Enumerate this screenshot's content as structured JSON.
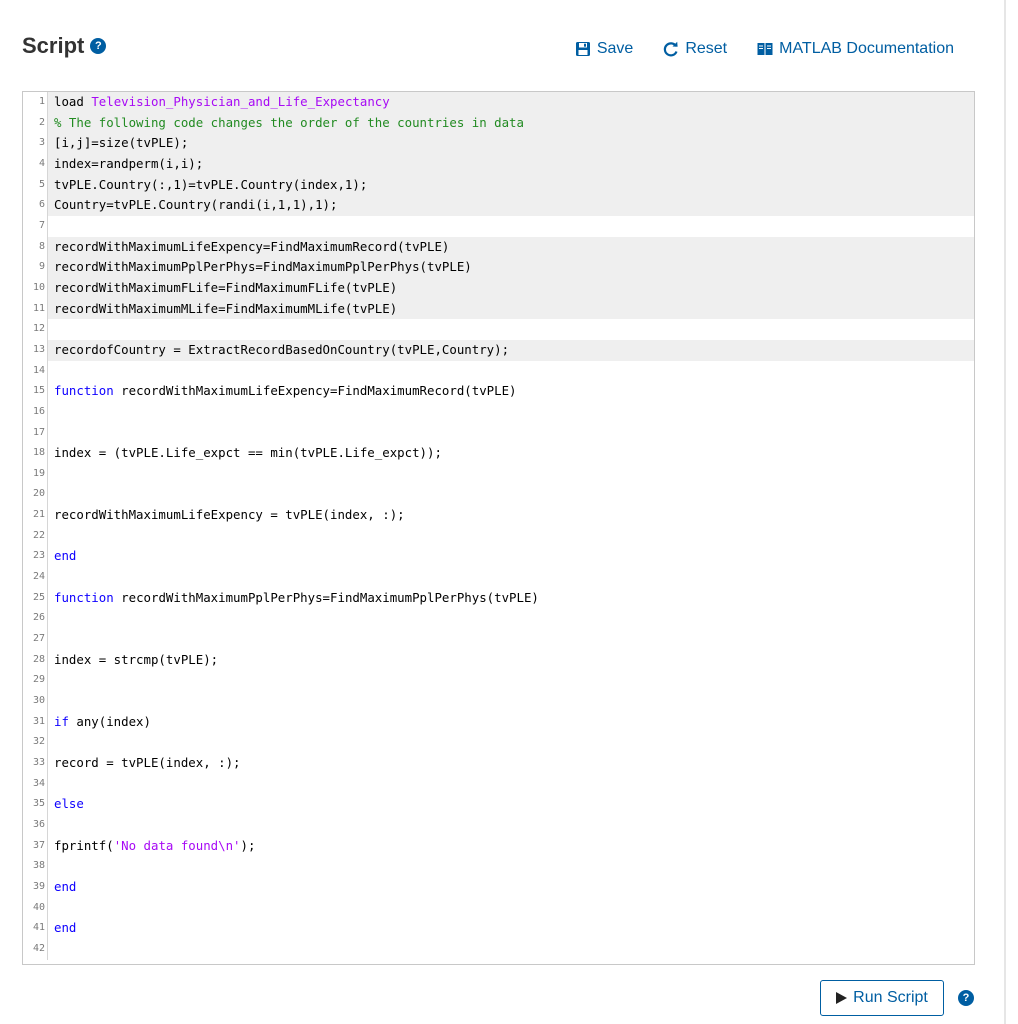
{
  "header": {
    "title": "Script",
    "help_glyph": "?",
    "toolbar": {
      "save_label": "Save",
      "reset_label": "Reset",
      "docs_label": "MATLAB Documentation"
    }
  },
  "editor": {
    "lines": [
      {
        "n": "1",
        "shaded": true,
        "parts": [
          {
            "t": "load "
          },
          {
            "t": "Television_Physician_and_Life_Expectancy",
            "c": "str"
          }
        ]
      },
      {
        "n": "2",
        "shaded": true,
        "parts": [
          {
            "t": "% The following code changes the order of the countries in data",
            "c": "cmt"
          }
        ]
      },
      {
        "n": "3",
        "shaded": true,
        "parts": [
          {
            "t": "[i,j]=size(tvPLE);"
          }
        ]
      },
      {
        "n": "4",
        "shaded": true,
        "parts": [
          {
            "t": "index=randperm(i,i);"
          }
        ]
      },
      {
        "n": "5",
        "shaded": true,
        "parts": [
          {
            "t": "tvPLE.Country(:,1)=tvPLE.Country(index,1);"
          }
        ]
      },
      {
        "n": "6",
        "shaded": true,
        "parts": [
          {
            "t": "Country=tvPLE.Country(randi(i,1,1),1);"
          }
        ]
      },
      {
        "n": "7",
        "shaded": false,
        "parts": []
      },
      {
        "n": "8",
        "shaded": true,
        "parts": [
          {
            "t": "recordWithMaximumLifeExpency=FindMaximumRecord(tvPLE)"
          }
        ]
      },
      {
        "n": "9",
        "shaded": true,
        "parts": [
          {
            "t": "recordWithMaximumPplPerPhys=FindMaximumPplPerPhys(tvPLE)"
          }
        ]
      },
      {
        "n": "10",
        "shaded": true,
        "parts": [
          {
            "t": "recordWithMaximumFLife=FindMaximumFLife(tvPLE)"
          }
        ]
      },
      {
        "n": "11",
        "shaded": true,
        "parts": [
          {
            "t": "recordWithMaximumMLife=FindMaximumMLife(tvPLE)"
          }
        ]
      },
      {
        "n": "12",
        "shaded": false,
        "parts": []
      },
      {
        "n": "13",
        "shaded": true,
        "parts": [
          {
            "t": "recordofCountry = ExtractRecordBasedOnCountry(tvPLE,Country);"
          }
        ]
      },
      {
        "n": "14",
        "shaded": false,
        "parts": []
      },
      {
        "n": "15",
        "shaded": false,
        "parts": [
          {
            "t": "function",
            "c": "kw"
          },
          {
            "t": " recordWithMaximumLifeExpency=FindMaximumRecord(tvPLE)"
          }
        ]
      },
      {
        "n": "16",
        "shaded": false,
        "parts": []
      },
      {
        "n": "17",
        "shaded": false,
        "parts": []
      },
      {
        "n": "18",
        "shaded": false,
        "parts": [
          {
            "t": "index = (tvPLE.Life_expct == min(tvPLE.Life_expct));"
          }
        ]
      },
      {
        "n": "19",
        "shaded": false,
        "parts": []
      },
      {
        "n": "20",
        "shaded": false,
        "parts": []
      },
      {
        "n": "21",
        "shaded": false,
        "parts": [
          {
            "t": "recordWithMaximumLifeExpency = tvPLE(index, :);"
          }
        ]
      },
      {
        "n": "22",
        "shaded": false,
        "parts": []
      },
      {
        "n": "23",
        "shaded": false,
        "parts": [
          {
            "t": "end",
            "c": "kw"
          }
        ]
      },
      {
        "n": "24",
        "shaded": false,
        "parts": []
      },
      {
        "n": "25",
        "shaded": false,
        "parts": [
          {
            "t": "function",
            "c": "kw"
          },
          {
            "t": " recordWithMaximumPplPerPhys=FindMaximumPplPerPhys(tvPLE)"
          }
        ]
      },
      {
        "n": "26",
        "shaded": false,
        "parts": []
      },
      {
        "n": "27",
        "shaded": false,
        "parts": []
      },
      {
        "n": "28",
        "shaded": false,
        "parts": [
          {
            "t": "index = strcmp(tvPLE);"
          }
        ]
      },
      {
        "n": "29",
        "shaded": false,
        "parts": []
      },
      {
        "n": "30",
        "shaded": false,
        "parts": []
      },
      {
        "n": "31",
        "shaded": false,
        "parts": [
          {
            "t": "if",
            "c": "kw"
          },
          {
            "t": " any(index)"
          }
        ]
      },
      {
        "n": "32",
        "shaded": false,
        "parts": []
      },
      {
        "n": "33",
        "shaded": false,
        "parts": [
          {
            "t": "record = tvPLE(index, :);"
          }
        ]
      },
      {
        "n": "34",
        "shaded": false,
        "parts": []
      },
      {
        "n": "35",
        "shaded": false,
        "parts": [
          {
            "t": "else",
            "c": "kw"
          }
        ]
      },
      {
        "n": "36",
        "shaded": false,
        "parts": []
      },
      {
        "n": "37",
        "shaded": false,
        "parts": [
          {
            "t": "fprintf("
          },
          {
            "t": "'No data found\\n'",
            "c": "str"
          },
          {
            "t": ");"
          }
        ]
      },
      {
        "n": "38",
        "shaded": false,
        "parts": []
      },
      {
        "n": "39",
        "shaded": false,
        "parts": [
          {
            "t": "end",
            "c": "kw"
          }
        ]
      },
      {
        "n": "40",
        "shaded": false,
        "parts": []
      },
      {
        "n": "41",
        "shaded": false,
        "parts": [
          {
            "t": "end",
            "c": "kw"
          }
        ]
      },
      {
        "n": "42",
        "shaded": false,
        "parts": []
      }
    ]
  },
  "footer": {
    "run_label": "Run Script",
    "help_glyph": "?"
  },
  "colors": {
    "accent": "#005ea2",
    "keyword": "#0e00ff",
    "string": "#a709f5",
    "comment": "#228b22",
    "shaded_line": "#efefef"
  }
}
